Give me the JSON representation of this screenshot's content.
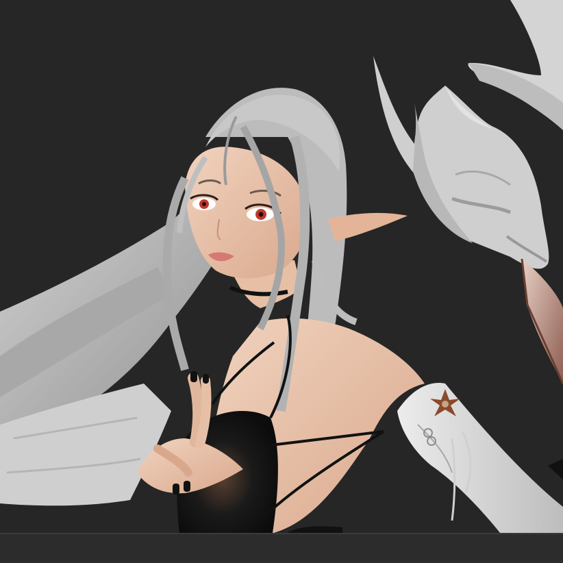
{
  "scene": {
    "subject": "elf-sculpt-render",
    "colors": {
      "background": "#262626",
      "bottom_bar": "#2c2c2c",
      "hair": "#b9b9b9",
      "skin": "#e9c2a8",
      "eye": "#c0392b",
      "top": "#151515",
      "sleeve": "#d6d6d6",
      "mask": "#cfcfcf",
      "crystal": "#c99a8a",
      "brooch": "#8a4a2c"
    },
    "icons": [
      "fox-mask-icon",
      "shuriken-brooch-icon",
      "crystal-blade-icon"
    ]
  }
}
